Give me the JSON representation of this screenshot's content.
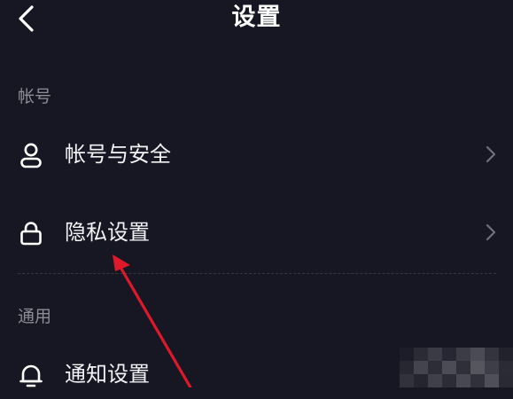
{
  "header": {
    "title": "设置",
    "back_icon": "chevron-left-icon"
  },
  "sections": [
    {
      "label": "帐号",
      "items": [
        {
          "label": "帐号与安全",
          "icon": "user-icon",
          "has_chevron": true
        },
        {
          "label": "隐私设置",
          "icon": "lock-icon",
          "has_chevron": true
        }
      ]
    },
    {
      "label": "通用",
      "items": [
        {
          "label": "通知设置",
          "icon": "bell-icon",
          "has_chevron": false
        }
      ]
    }
  ],
  "colors": {
    "background": "#161722",
    "text_primary": "#f2f2f4",
    "text_secondary": "#8c8d95",
    "divider": "#343641",
    "annotation_arrow": "#e0192a"
  }
}
